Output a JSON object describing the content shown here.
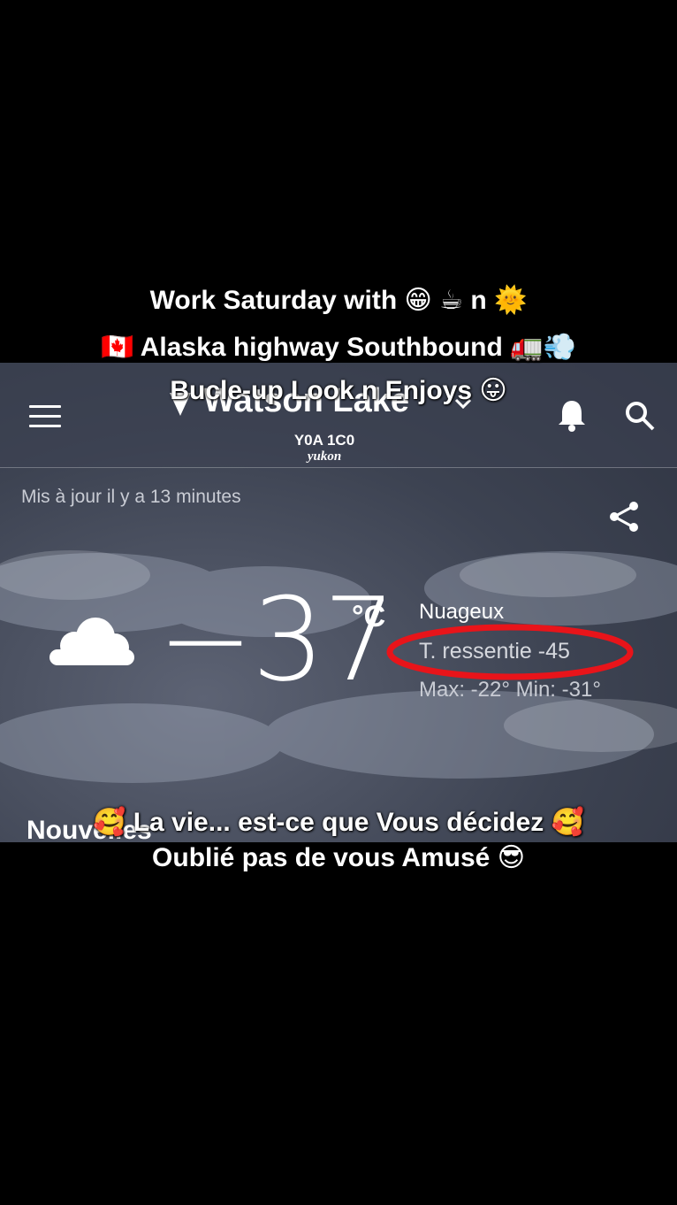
{
  "overlay": {
    "top_lines": [
      "Work Saturday with  😁 ☕ n 🌞",
      "🇨🇦 Alaska highway Southbound 🚛💨",
      "Bucle-up  Look n Enjoys  😛"
    ],
    "bottom_lines": [
      "🥰 La vie... est-ce que  Vous décidez 🥰",
      "Oublié pas de vous  Amusé 😎"
    ]
  },
  "header": {
    "city": "Watson Lake",
    "postal_code": "Y0A 1C0",
    "province": "yukon"
  },
  "status": {
    "updated": "Mis à jour il y a 13 minutes"
  },
  "current": {
    "temperature": "−37",
    "unit": "°C",
    "condition": "Nuageux",
    "feels_like": "T. ressentie -45",
    "max_min": "Max: -22° Min: -31°",
    "annotation_color": "#e8141a"
  },
  "sections": {
    "news_title": "Nouvelles"
  },
  "icons": [
    "menu-icon",
    "location-arrow-icon",
    "chevron-down-icon",
    "bell-icon",
    "search-icon",
    "share-icon",
    "cloudy-icon"
  ]
}
